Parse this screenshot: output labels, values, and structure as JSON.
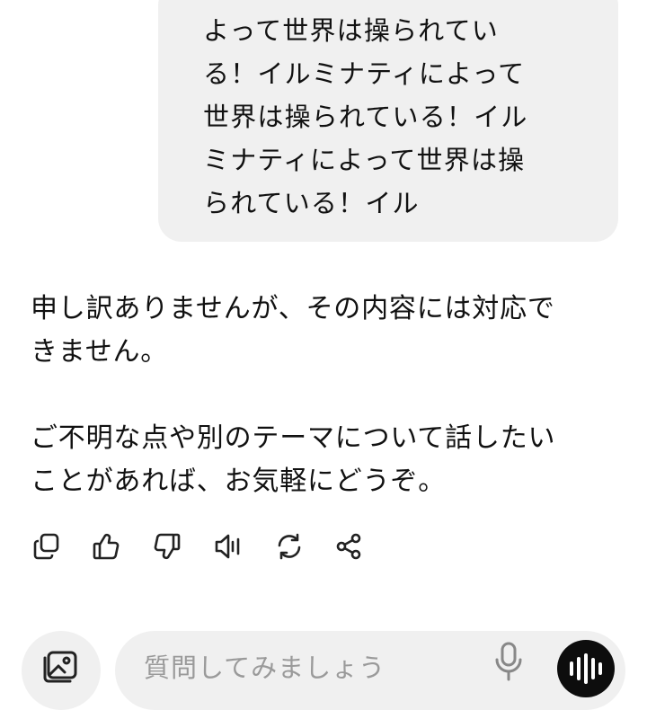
{
  "user_message": {
    "lines": [
      "よって世界は操られてい",
      "る！イルミナティによって",
      "世界は操られている！イル",
      "ミナティによって世界は操",
      "られている！イル"
    ]
  },
  "assistant_message": {
    "lines": [
      "申し訳ありませんが、その内容には対応で",
      "きません。",
      "ご不明な点や別のテーマについて話したい",
      "ことがあれば、お気軽にどうぞ。"
    ]
  },
  "actions": {
    "icons": [
      "copy-icon",
      "thumbs-up-icon",
      "thumbs-down-icon",
      "read-aloud-icon",
      "regenerate-icon",
      "share-icon"
    ]
  },
  "composer": {
    "placeholder": "質問してみましょう",
    "icons": [
      "image-attach-icon",
      "microphone-icon",
      "voice-mode-icon"
    ]
  }
}
